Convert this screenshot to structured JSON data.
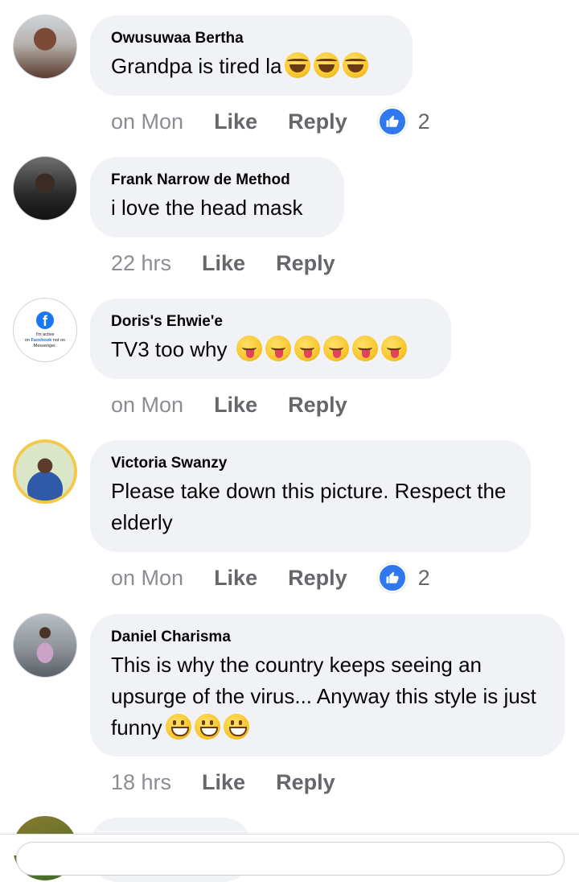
{
  "comments": [
    {
      "author": "Owusuwaa Bertha",
      "text": "Grandpa is tired la",
      "emojis": [
        "laugh",
        "laugh",
        "laugh"
      ],
      "time": "on Mon",
      "like": "Like",
      "reply": "Reply",
      "reactions": "2"
    },
    {
      "author": "Frank Narrow de Method",
      "text": "i love the head mask",
      "emojis": [],
      "time": "22 hrs",
      "like": "Like",
      "reply": "Reply"
    },
    {
      "author": "Doris's Ehwie'e",
      "text": "TV3 too why",
      "emojis": [
        "tongue",
        "tongue",
        "tongue",
        "tongue",
        "tongue",
        "tongue"
      ],
      "time": "on Mon",
      "like": "Like",
      "reply": "Reply",
      "avatar_text": {
        "line1": "I'm active",
        "line2a": "on ",
        "line2b": "Facebook",
        "line2c": " not on",
        "line3": "Messenger."
      }
    },
    {
      "author": "Victoria Swanzy",
      "text": "Please take down this picture. Respect the elderly",
      "emojis": [],
      "time": "on Mon",
      "like": "Like",
      "reply": "Reply",
      "reactions": "2"
    },
    {
      "author": "Daniel Charisma",
      "text": "This is why the country keeps seeing an upsurge of the virus... Anyway this style is just funny",
      "emojis": [
        "grin",
        "grin",
        "grin"
      ],
      "time": "18 hrs",
      "like": "Like",
      "reply": "Reply"
    }
  ],
  "colors": {
    "bubble": "#f0f2f5",
    "like_blue": "#2f78ee",
    "muted": "#65676b"
  },
  "icons": {
    "reaction": "thumbs-up-icon",
    "fb": "facebook-logo-icon"
  }
}
